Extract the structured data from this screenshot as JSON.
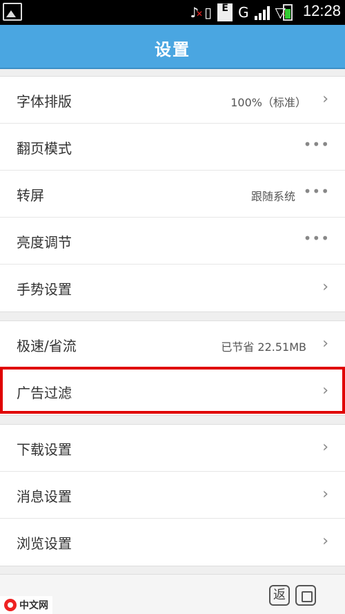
{
  "status_bar": {
    "time": "12:28",
    "network_letter": "G",
    "sim_letter": "E"
  },
  "title": "设置",
  "groups": [
    {
      "rows": [
        {
          "label": "字体排版",
          "value": "100%（标准）",
          "control": "chevron"
        },
        {
          "label": "翻页模式",
          "value": "",
          "control": "dots"
        },
        {
          "label": "转屏",
          "value": "跟随系统",
          "control": "dots"
        },
        {
          "label": "亮度调节",
          "value": "",
          "control": "dots"
        },
        {
          "label": "手势设置",
          "value": "",
          "control": "chevron"
        }
      ]
    },
    {
      "rows": [
        {
          "label": "极速/省流",
          "value": "已节省 22.51MB",
          "control": "chevron"
        },
        {
          "label": "广告过滤",
          "value": "",
          "control": "chevron",
          "highlighted": true
        }
      ]
    },
    {
      "rows": [
        {
          "label": "下载设置",
          "value": "",
          "control": "chevron"
        },
        {
          "label": "消息设置",
          "value": "",
          "control": "chevron"
        },
        {
          "label": "浏览设置",
          "value": "",
          "control": "chevron"
        }
      ]
    }
  ],
  "glyphs": {
    "chevron": "›",
    "dots": "•••"
  },
  "bottom_bar": {
    "back_label": "返"
  },
  "watermark": {
    "text": "中文网"
  },
  "colors": {
    "title_bar": "#4aa6e1",
    "highlight_border": "#e00000"
  }
}
